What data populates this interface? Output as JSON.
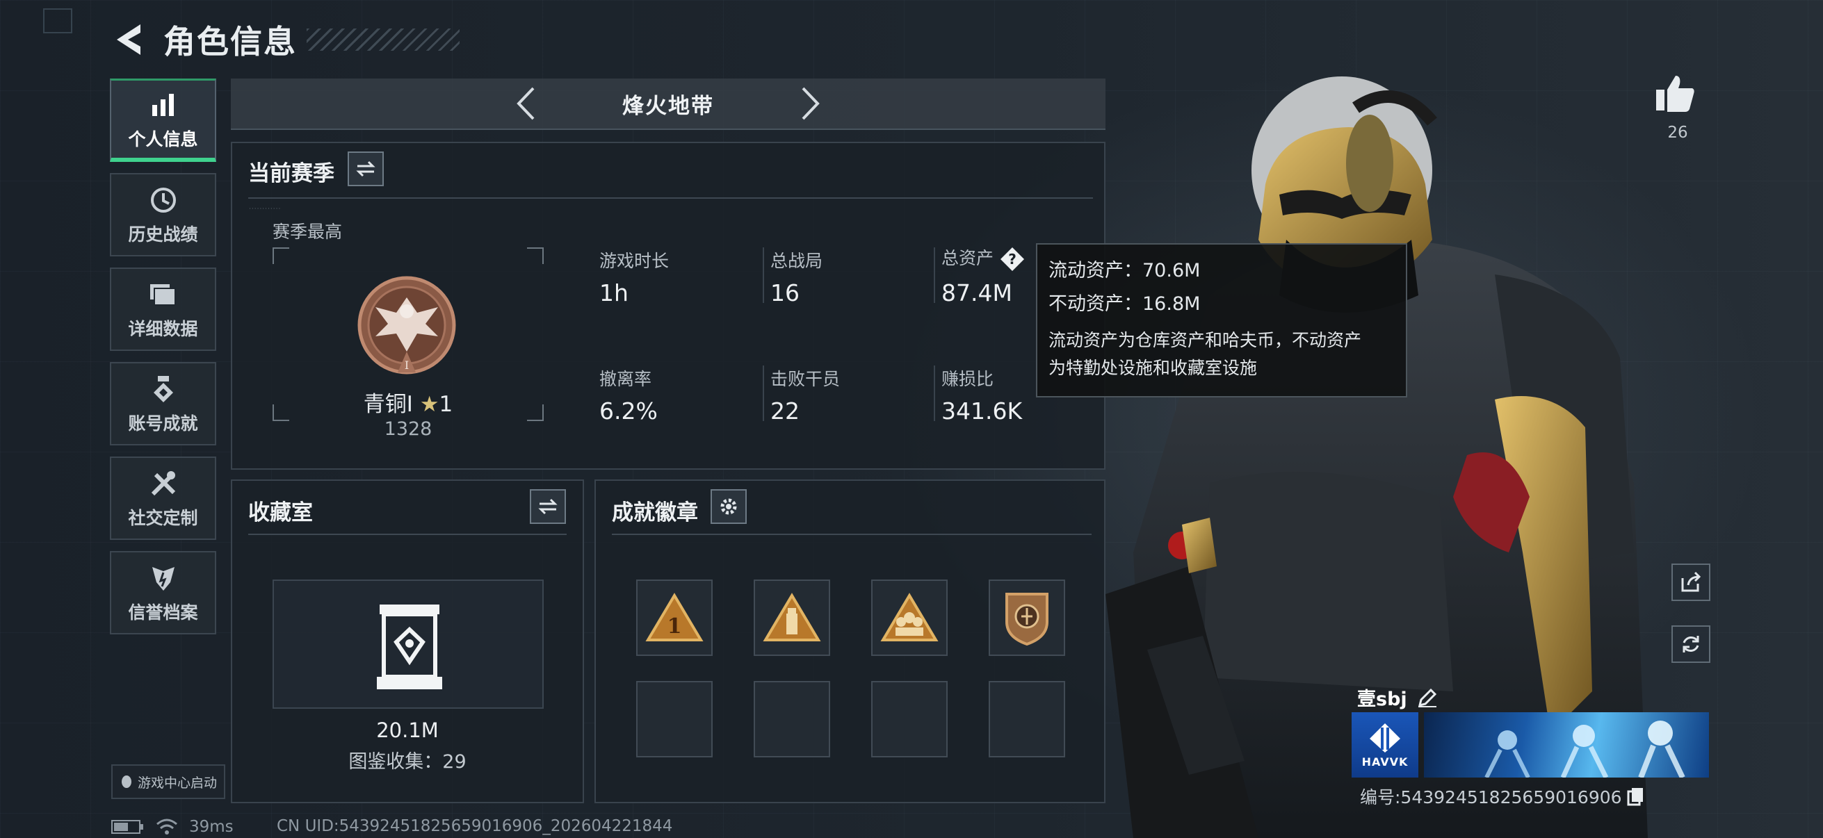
{
  "header": {
    "title": "角色信息"
  },
  "sidebar": {
    "items": [
      {
        "label": "个人信息",
        "icon": "bar-chart-icon",
        "active": true
      },
      {
        "label": "历史战绩",
        "icon": "history-icon",
        "active": false
      },
      {
        "label": "详细数据",
        "icon": "folder-icon",
        "active": false
      },
      {
        "label": "账号成就",
        "icon": "medal-icon",
        "active": false
      },
      {
        "label": "社交定制",
        "icon": "tools-icon",
        "active": false
      },
      {
        "label": "信誉档案",
        "icon": "shield-icon",
        "active": false
      }
    ],
    "launch_badge": "游戏中心启动"
  },
  "mode_selector": {
    "label": "烽火地带"
  },
  "season": {
    "title": "当前赛季",
    "best_label": "赛季最高",
    "rank_name": "青铜I",
    "rank_star": "★",
    "rank_stars": "1",
    "rank_points": "1328",
    "stats": [
      {
        "label": "游戏时长",
        "value": "1h"
      },
      {
        "label": "总战局",
        "value": "16"
      },
      {
        "label": "总资产",
        "value": "87.4M"
      },
      {
        "label": "撤离率",
        "value": "6.2%"
      },
      {
        "label": "击败干员",
        "value": "22"
      },
      {
        "label": "赚损比",
        "value": "341.6K"
      }
    ]
  },
  "tooltip": {
    "liquid": "流动资产：70.6M",
    "fixed": "不动资产：16.8M",
    "desc_line1": "流动资产为仓库资产和哈夫币，不动资产",
    "desc_line2": "为特勤处设施和收藏室设施"
  },
  "collection": {
    "title": "收藏室",
    "value": "20.1M",
    "count": "图鉴收集：29"
  },
  "achievements": {
    "title": "成就徽章",
    "badges": [
      "badge-rank-1",
      "badge-tower",
      "badge-squad",
      "badge-shield"
    ]
  },
  "profile": {
    "likes": "26",
    "name": "壹sbj",
    "banner_logo": "HAVVK",
    "id": "编号:5439245182565901​6906"
  },
  "status": {
    "ping": "39ms",
    "uid": "CN UID:54392451825659016906_202604221844"
  },
  "colors": {
    "accent": "#3fd28e",
    "panel": "#1a2128",
    "gold": "#c9a24a"
  }
}
